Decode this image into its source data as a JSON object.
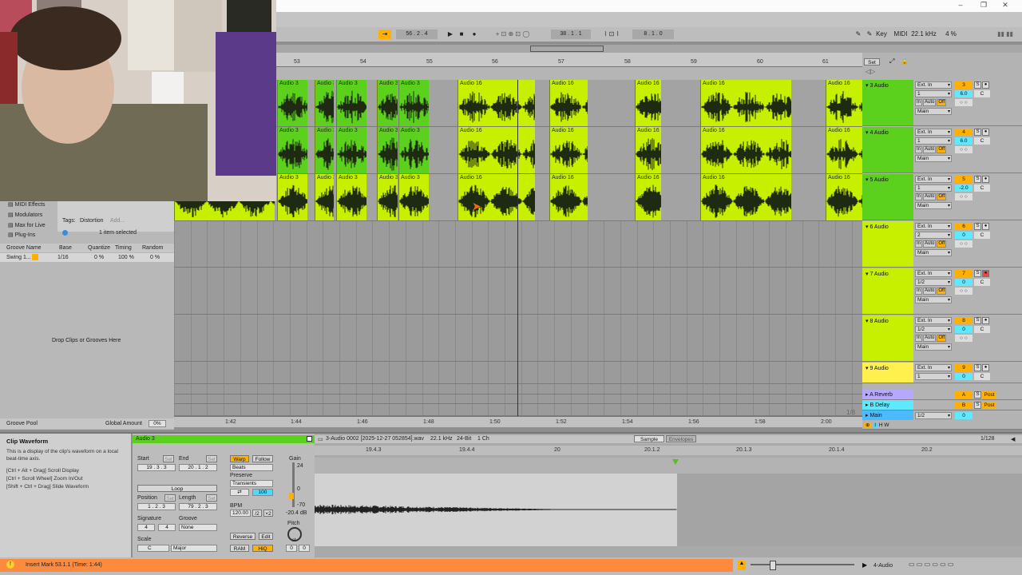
{
  "colors": {
    "clip_green": "#5bd11d",
    "clip_lime": "#c7f000",
    "track_yellow": "#fff04d",
    "track_purple": "#b7a8ff",
    "track_blue": "#4db9ff",
    "track_cyan": "#5fe9ff",
    "orange": "#ff8a3d",
    "arm_red": "#ff4040"
  },
  "transport": {
    "tempo_position": "56 . 2 . 4",
    "position": "38 . 1 . 1",
    "loop_length": "8 . 1 . 0",
    "key_label": "Key",
    "midi_label": "MIDI",
    "sample_rate": "22.1 kHz",
    "cpu": "4 %"
  },
  "ruler": {
    "ticks": [
      "53",
      "54",
      "55",
      "56",
      "57",
      "58",
      "59",
      "60",
      "61"
    ],
    "set_label": "Set"
  },
  "timeline": {
    "ticks": [
      "1:42",
      "1:44",
      "1:46",
      "1:48",
      "1:50",
      "1:52",
      "1:54",
      "1:56",
      "1:58",
      "2:00"
    ],
    "zoom": "1/8"
  },
  "tracks": [
    {
      "name": "3 Audio",
      "input": "Ext. In",
      "channel": "1",
      "number": "3",
      "volume": "6.0",
      "pan": "C",
      "output": "Main"
    },
    {
      "name": "4 Audio",
      "input": "Ext. In",
      "channel": "1",
      "number": "4",
      "volume": "6.0",
      "pan": "C",
      "output": "Main"
    },
    {
      "name": "5 Audio",
      "input": "Ext. In",
      "channel": "1",
      "number": "5",
      "volume": "-2.0",
      "pan": "C",
      "output": "Main"
    },
    {
      "name": "6 Audio",
      "input": "Ext. In",
      "channel": "2",
      "number": "6",
      "volume": "0",
      "pan": "C",
      "output": "Main"
    },
    {
      "name": "7 Audio",
      "input": "Ext. In",
      "channel": "1/2",
      "number": "7",
      "volume": "0",
      "pan": "C",
      "output": "Main"
    },
    {
      "name": "8 Audio",
      "input": "Ext. In",
      "channel": "1/2",
      "number": "8",
      "volume": "0",
      "pan": "C",
      "output": "Main"
    },
    {
      "name": "9 Audio",
      "input": "Ext. In",
      "channel": "1",
      "number": "9",
      "volume": "0",
      "pan": "C",
      "output": "Main"
    }
  ],
  "returns": [
    {
      "name": "A Reverb",
      "letter": "A",
      "post": "Post"
    },
    {
      "name": "B Delay",
      "letter": "B",
      "post": "Post"
    }
  ],
  "main": {
    "name": "Main",
    "channel": "1/2",
    "volume": "0"
  },
  "io_labels": {
    "in": "In",
    "auto": "Auto",
    "off": "Off",
    "solo": "S"
  },
  "clip_names": {
    "a3": "Audio 3",
    "a16": "Audio 16"
  },
  "browser": {
    "items": [
      "MIDI Effects",
      "Modulators",
      "Max for Live",
      "Plug-Ins"
    ],
    "tags_label": "Tags:",
    "tag": "Distortion",
    "add": "Add...",
    "selected": "1 item selected",
    "groove_headers": [
      "Groove Name",
      "Base",
      "Quantize",
      "Timing",
      "Random"
    ],
    "groove_row": [
      "Swing 1...",
      "1/16",
      "0 %",
      "100 %",
      "0 %"
    ],
    "drop_hint": "Drop Clips or Grooves Here",
    "groove_pool": "Groove Pool",
    "global_amount_label": "Global Amount",
    "global_amount": "0%"
  },
  "info": {
    "title": "Clip Waveform",
    "body": "This is a display of the clip's waveform on a local beat-time axis.",
    "tips": [
      "[Ctrl + Alt + Drag] Scroll Display",
      "[Ctrl + Scroll Wheel] Zoom In/Out",
      "[Shift + Ctrl + Drag] Slide Waveform"
    ]
  },
  "clip": {
    "name": "Audio 3",
    "start_label": "Start",
    "end_label": "End",
    "set": "Set",
    "start": "19 . 3 . 3",
    "end": "20 . 1 . 2",
    "loop": "Loop",
    "position_label": "Position",
    "length_label": "Length",
    "position": "1 . 2 . 3",
    "length": "79 . 2 . 3",
    "signature_label": "Signature",
    "groove_label": "Groove",
    "sig_num": "4",
    "sig_den": "4",
    "groove": "None",
    "scale_label": "Scale",
    "scale_root": "C",
    "scale_mode": "Major",
    "warp": "Warp",
    "follow": "Follow",
    "beats": "Beats",
    "preserve_label": "Preserve",
    "preserve": "Transients",
    "transient_val": "100",
    "bpm_label": "BPM",
    "bpm": "120.00",
    "half": "/2",
    "double": "×2",
    "reverse": "Reverse",
    "edit": "Edit",
    "ram": "RAM",
    "hiq": "HiQ",
    "gain_label": "Gain",
    "gain_max": "24",
    "gain_zero": "0",
    "gain_min": "-70",
    "gain": "-20.4 dB",
    "pitch_label": "Pitch",
    "pitch_unit": "st",
    "pitch": "0",
    "detune": "0"
  },
  "sample": {
    "file": "3-Audio 0002 [2025-12-27 052854].wav",
    "rate": "22.1 kHz",
    "bits": "24-Bit",
    "channels": "1 Ch",
    "tab_sample": "Sample",
    "tab_env": "Envelopes",
    "grid": "1/128",
    "ruler": [
      "19.4.3",
      "19.4.4",
      "20",
      "20.1.2",
      "20.1.3",
      "20.1.4",
      "20.2"
    ]
  },
  "status": {
    "message": "Insert Mark 53.1.1 (Time: 1:44)",
    "track": "4-Audio"
  }
}
